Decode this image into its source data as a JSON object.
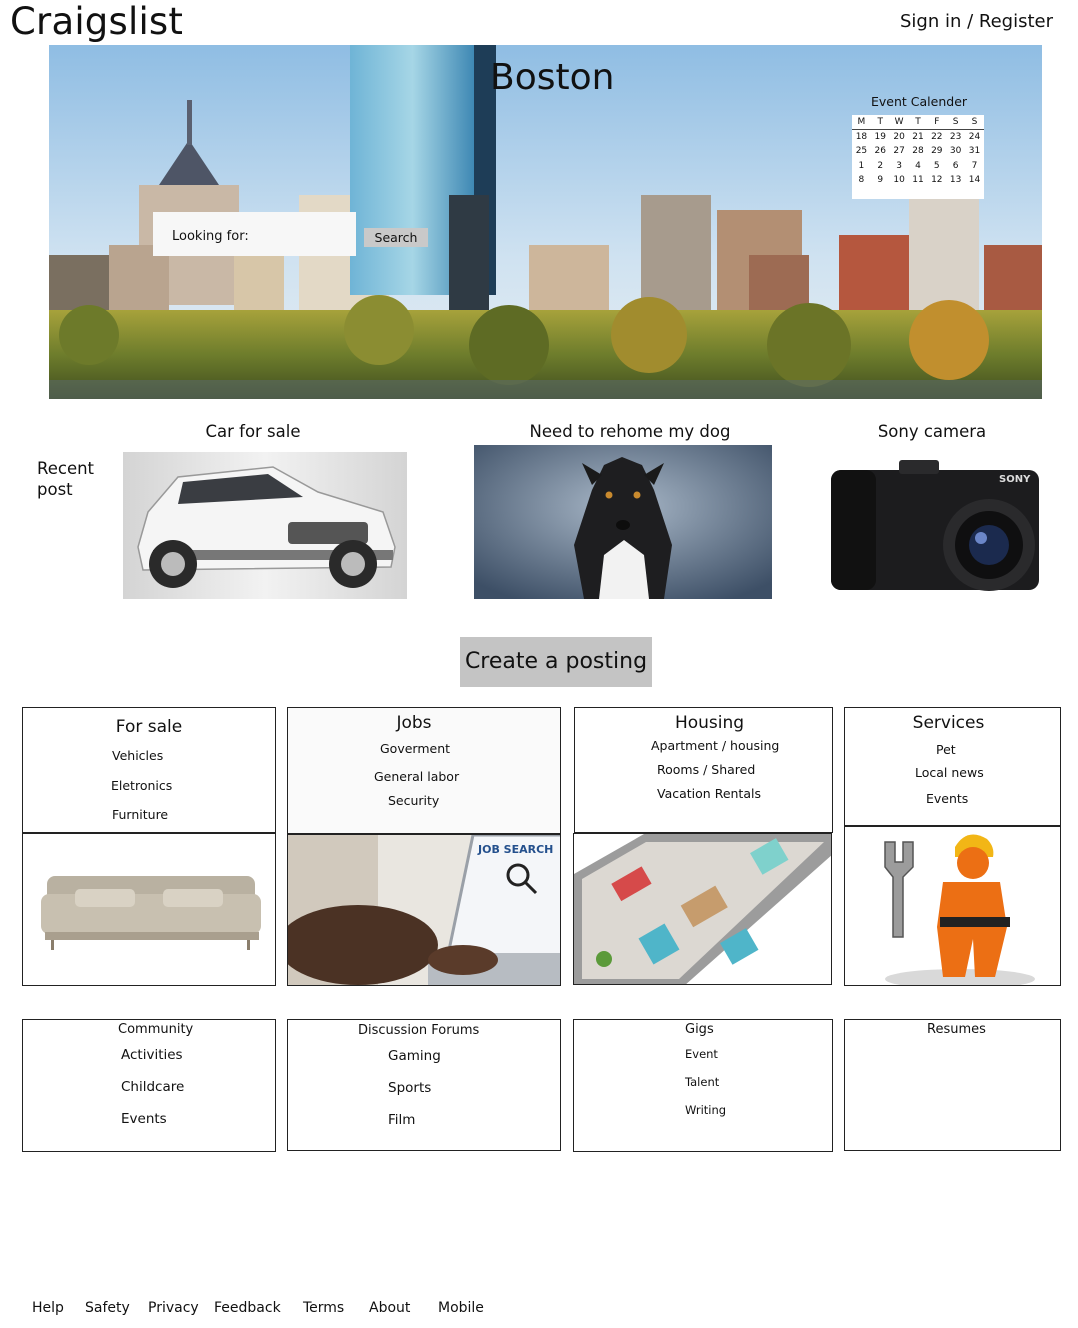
{
  "header": {
    "logo": "Craigslist",
    "signin": "Sign in / Register"
  },
  "hero": {
    "city": "Boston",
    "search": {
      "label": "Looking for:",
      "button": "Search"
    },
    "calendar": {
      "title": "Event Calender",
      "days": [
        "M",
        "T",
        "W",
        "T",
        "F",
        "S",
        "S"
      ],
      "weeks": [
        [
          "18",
          "19",
          "20",
          "21",
          "22",
          "23",
          "24"
        ],
        [
          "25",
          "26",
          "27",
          "28",
          "29",
          "30",
          "31"
        ],
        [
          "1",
          "2",
          "3",
          "4",
          "5",
          "6",
          "7"
        ],
        [
          "8",
          "9",
          "10",
          "11",
          "12",
          "13",
          "14"
        ]
      ]
    }
  },
  "recent": {
    "label": "Recent post",
    "posts": [
      {
        "title": "Car for sale"
      },
      {
        "title": "Need to rehome my dog"
      },
      {
        "title": "Sony camera"
      }
    ]
  },
  "create_button": "Create a posting",
  "categories": {
    "for_sale": {
      "title": "For sale",
      "items": [
        "Vehicles",
        "Eletronics",
        "Furniture"
      ]
    },
    "jobs": {
      "title": "Jobs",
      "items": [
        "Goverment",
        "General labor",
        "Security"
      ],
      "image_text": "JOB SEARCH"
    },
    "housing": {
      "title": "Housing",
      "items": [
        "Apartment / housing",
        "Rooms / Shared",
        "Vacation Rentals"
      ]
    },
    "services": {
      "title": "Services",
      "items": [
        "Pet",
        "Local news",
        "Events"
      ]
    }
  },
  "more": {
    "community": {
      "title": "Community",
      "items": [
        "Activities",
        "Childcare",
        "Events"
      ]
    },
    "forums": {
      "title": "Discussion Forums",
      "items": [
        "Gaming",
        "Sports",
        "Film"
      ]
    },
    "gigs": {
      "title": "Gigs",
      "items": [
        "Event",
        "Talent",
        "Writing"
      ]
    },
    "resumes": {
      "title": "Resumes"
    }
  },
  "footer": [
    "Help",
    "Safety",
    "Privacy",
    "Feedback",
    "Terms",
    "About",
    "Mobile"
  ],
  "colors": {
    "button_gray": "#c4c4c4",
    "search_bg": "#f7f7f7",
    "border": "#222222"
  }
}
